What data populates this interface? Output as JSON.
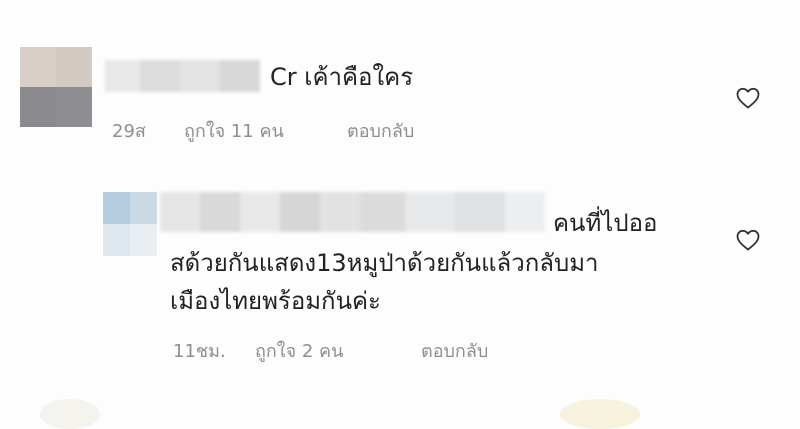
{
  "comments": [
    {
      "text": "Cr เค้าคือใคร",
      "time": "29ส",
      "likes": "ถูกใจ 11 คน",
      "reply": "ตอบกลับ"
    },
    {
      "text_line1": "คนที่ไปออ",
      "text_line2": "สด้วยกันแสดง13หมูป่าด้วยกันแล้วกลับมา",
      "text_line3": "เมืองไทยพร้อมกันค่ะ",
      "time": "11ชม.",
      "likes": "ถูกใจ 2 คน",
      "reply": "ตอบกลับ"
    }
  ],
  "icons": {
    "like": "heart-outline-icon"
  },
  "colors": {
    "text": "#222222",
    "meta": "#8e8e8e",
    "background": "#fdfdfd"
  }
}
